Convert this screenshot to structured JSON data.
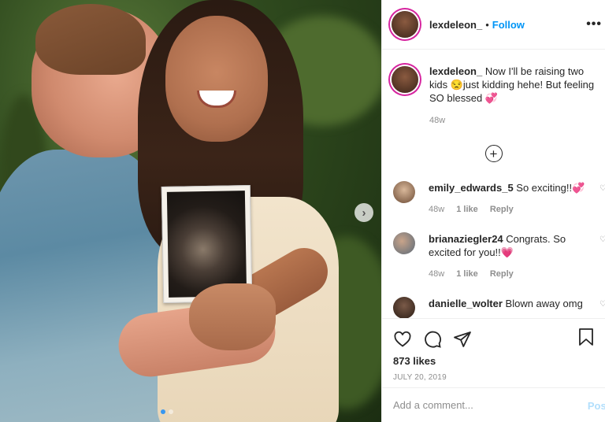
{
  "post": {
    "username": "lexdeleon_",
    "follow_label": "Follow",
    "separator": "•",
    "more_label": "•••"
  },
  "caption": {
    "username": "lexdeleon_",
    "text": " Now I'll be raising two kids 😒just kidding hehe! But feeling SO blessed 💞",
    "time": "48w"
  },
  "load_more_icon": "plus-circle-icon",
  "comments": [
    {
      "username": "emily_edwards_5",
      "text": " So exciting!!💞",
      "time": "48w",
      "likes": "1 like",
      "reply": "Reply"
    },
    {
      "username": "brianaziegler24",
      "text": " Congrats. So excited for you!!💗",
      "time": "48w",
      "likes": "1 like",
      "reply": "Reply"
    },
    {
      "username": "danielle_wolter",
      "text": " Blown away omg"
    }
  ],
  "actions": {
    "likes": "873 likes",
    "date": "JULY 20, 2019"
  },
  "composer": {
    "placeholder": "Add a comment...",
    "post_label": "Post"
  },
  "carousel": {
    "slide": 1,
    "total": 2,
    "next_icon": "chevron-right-icon"
  },
  "colors": {
    "link": "#0095f6",
    "muted": "#8e8e8e",
    "post_disabled": "#b2dffc",
    "story_ring": "#d6249f"
  }
}
